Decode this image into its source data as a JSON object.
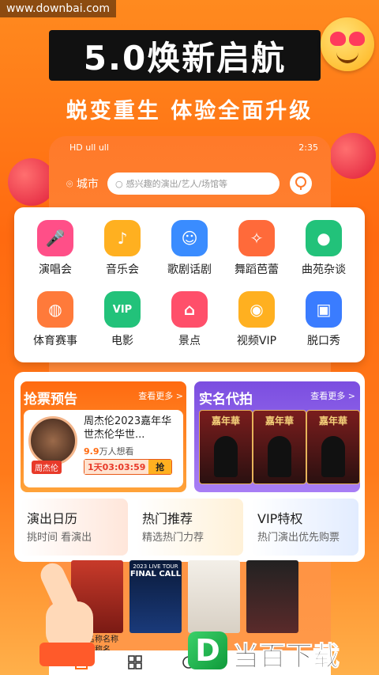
{
  "watermark": "www.downbai.com",
  "promo": {
    "title": "5.0焕新启航",
    "subtitle": "蜕变重生  体验全面升级"
  },
  "status_bar": {
    "left": "HD ull ull",
    "time": "2:35"
  },
  "header": {
    "city": "城市",
    "search_placeholder": "感兴趣的演出/艺人/场馆等"
  },
  "categories": [
    {
      "label": "演唱会",
      "icon": "microphone-icon",
      "color": "#ff4f88"
    },
    {
      "label": "音乐会",
      "icon": "piano-icon",
      "color": "#ffb020"
    },
    {
      "label": "歌剧话剧",
      "icon": "theater-mask-icon",
      "color": "#3a8cff"
    },
    {
      "label": "舞蹈芭蕾",
      "icon": "ballet-icon",
      "color": "#ff6a3a"
    },
    {
      "label": "曲苑杂谈",
      "icon": "pipa-icon",
      "color": "#22c27a"
    },
    {
      "label": "体育赛事",
      "icon": "basketball-icon",
      "color": "#ff7a3a"
    },
    {
      "label": "电影",
      "icon": "vip-crown-icon",
      "color": "#22c27a"
    },
    {
      "label": "景点",
      "icon": "landmark-icon",
      "color": "#ff4f6a"
    },
    {
      "label": "视频VIP",
      "icon": "film-reel-icon",
      "color": "#ffb020"
    },
    {
      "label": "脱口秀",
      "icon": "tv-icon",
      "color": "#3a7cff"
    }
  ],
  "ticket_preview": {
    "heading": "抢票预告",
    "more": "查看更多 >",
    "title": "周杰伦2023嘉年华世杰伦华世...",
    "avatar_tag": "周杰伦",
    "want_count": "9.9",
    "want_suffix": "万人想看",
    "timer": "1天03:03:59",
    "grab": "抢"
  },
  "realname": {
    "heading": "实名代拍",
    "more": "查看更多 >",
    "poster_text": "嘉年華"
  },
  "tiles": [
    {
      "title": "演出日历",
      "sub": "挑时间 看演出"
    },
    {
      "title": "热门推荐",
      "sub": "精选热门力荐"
    },
    {
      "title": "VIP特权",
      "sub": "热门演出优先购票"
    }
  ],
  "bottom_poster_names": "名称名称名称\n名称名称名",
  "poster_labels": [
    "FINAL CALL",
    "2023 LIVE TOUR"
  ],
  "watermark_logo": {
    "letter": "D",
    "text": "当百下载"
  }
}
